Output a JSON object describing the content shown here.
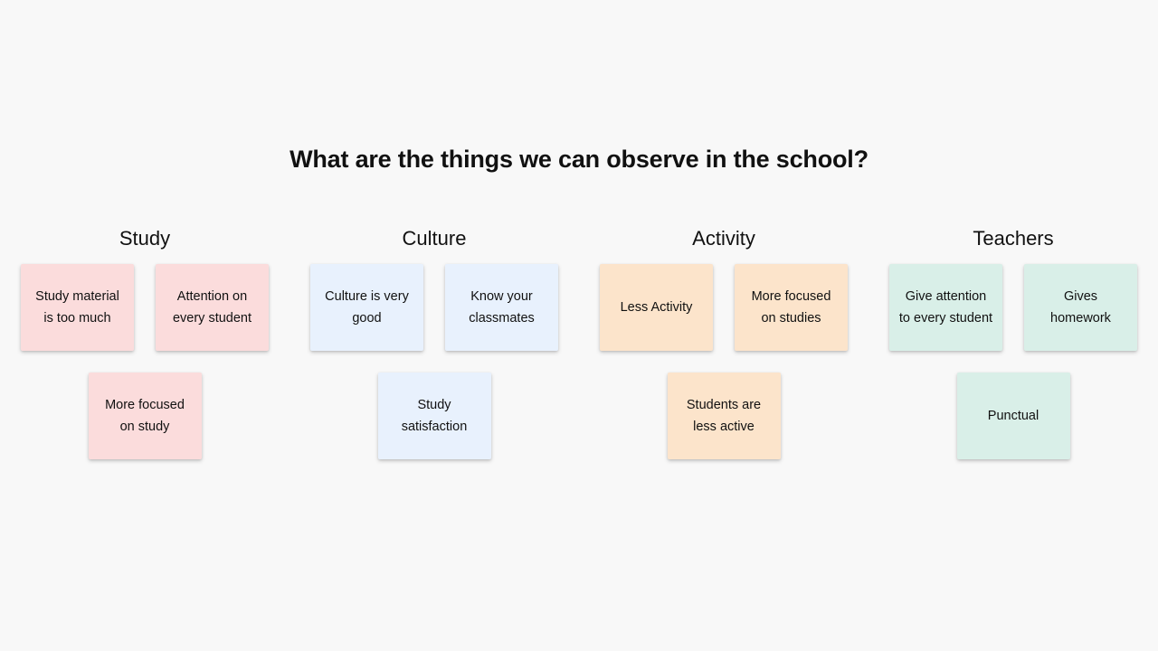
{
  "page": {
    "background_color": "#f8f8f8",
    "title": "What are the things we can observe in the school?"
  },
  "columns": [
    {
      "id": "study",
      "title": "Study",
      "card_color": "#fbdcdc",
      "rows": [
        [
          "Study material is too much",
          "Attention on every student"
        ],
        [
          "More focused on study"
        ]
      ]
    },
    {
      "id": "culture",
      "title": "Culture",
      "card_color": "#e8f1fd",
      "rows": [
        [
          "Culture is very good",
          "Know your classmates"
        ],
        [
          "Study satisfaction"
        ]
      ]
    },
    {
      "id": "activity",
      "title": "Activity",
      "card_color": "#fce4cb",
      "rows": [
        [
          "Less Activity",
          "More focused on studies"
        ],
        [
          "Students are less active"
        ]
      ]
    },
    {
      "id": "teachers",
      "title": "Teachers",
      "card_color": "#d9efe8",
      "rows": [
        [
          "Give attention to every student",
          "Gives homework"
        ],
        [
          "Punctual"
        ]
      ]
    }
  ]
}
